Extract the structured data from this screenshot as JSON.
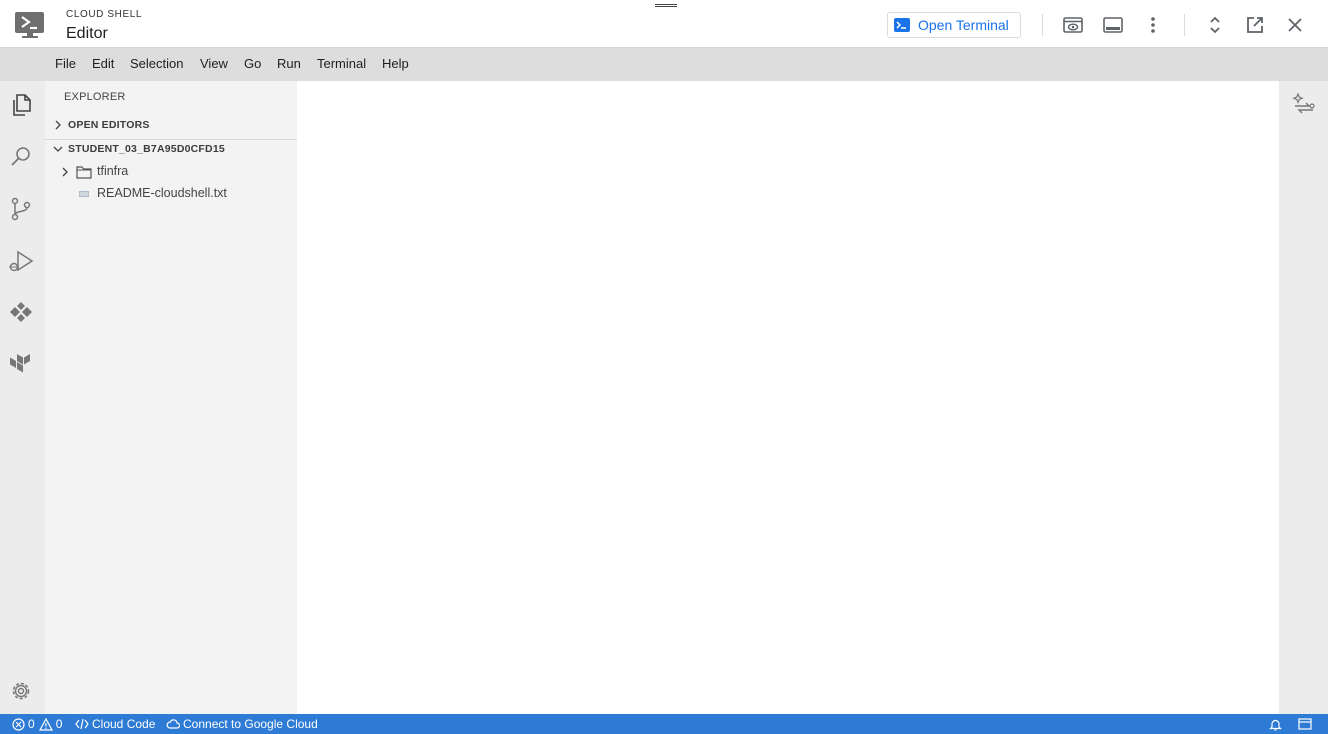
{
  "window": {
    "product_label": "CLOUD SHELL",
    "title": "Editor",
    "open_terminal_label": "Open Terminal"
  },
  "menu": [
    "File",
    "Edit",
    "Selection",
    "View",
    "Go",
    "Run",
    "Terminal",
    "Help"
  ],
  "explorer": {
    "title": "EXPLORER",
    "open_editors_label": "OPEN EDITORS",
    "workspace_label": "STUDENT_03_B7A95D0CFD15",
    "items": [
      {
        "name": "tfinfra",
        "type": "folder"
      },
      {
        "name": "README-cloudshell.txt",
        "type": "file"
      }
    ]
  },
  "status": {
    "errors": "0",
    "warnings": "0",
    "cloud_code": "Cloud Code",
    "connect": "Connect to Google Cloud"
  },
  "colors": {
    "accent": "#1a73e8",
    "statusbar": "#2d7bd4",
    "menubar": "#dddddd",
    "sidebar": "#f3f3f3"
  }
}
